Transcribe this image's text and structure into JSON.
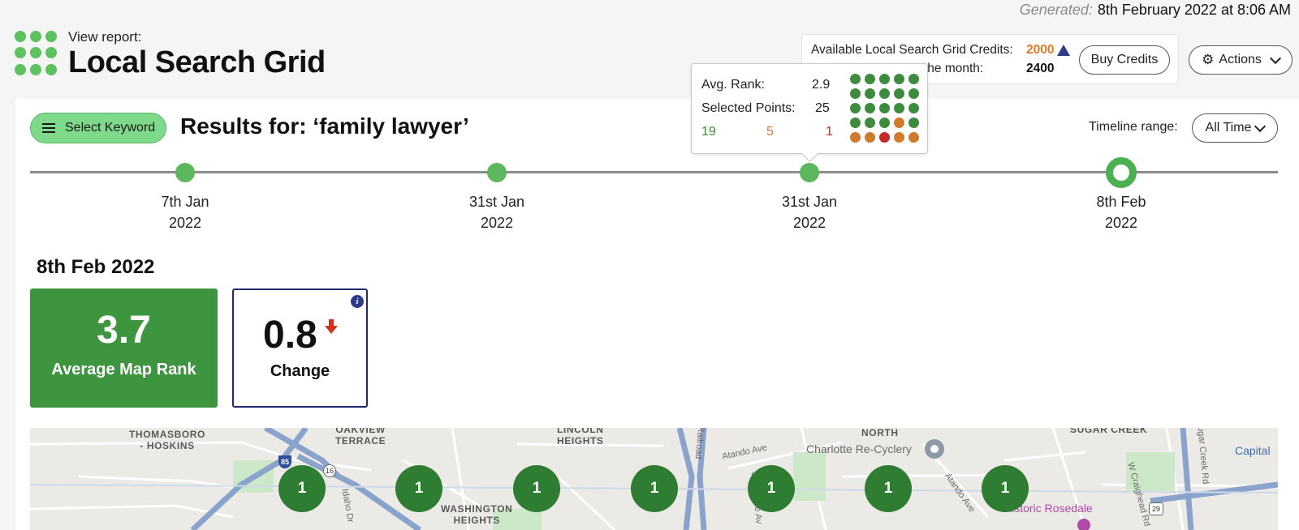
{
  "header": {
    "generated_label": "Generated:",
    "generated_value": "8th February 2022 at 8:06 AM",
    "view_report": "View report:",
    "title": "Local Search Grid"
  },
  "credits": {
    "available_label": "Available Local Search Grid Credits:",
    "available_value": "2000",
    "monthly_label": "the month:",
    "monthly_value": "2400",
    "buy_button": "Buy Credits",
    "warning_icon": "warning-triangle-icon"
  },
  "actions": {
    "label": "Actions",
    "icon": "gear-icon"
  },
  "keyword": {
    "select_button": "Select Keyword",
    "results_for": "Results for: ‘family lawyer’"
  },
  "timeline": {
    "range_label": "Timeline range:",
    "range_value": "All Time",
    "points": [
      {
        "day": "7th Jan",
        "year": "2022",
        "selected": false
      },
      {
        "day": "31st Jan",
        "year": "2022",
        "selected": false
      },
      {
        "day": "31st Jan",
        "year": "2022",
        "selected": false
      },
      {
        "day": "8th Feb",
        "year": "2022",
        "selected": true
      }
    ]
  },
  "tooltip": {
    "avg_rank_label": "Avg. Rank:",
    "avg_rank_value": "2.9",
    "selected_points_label": "Selected Points:",
    "selected_points_value": "25",
    "count_green": "19",
    "count_orange": "5",
    "count_red": "1",
    "grid_colors": [
      "green",
      "green",
      "green",
      "green",
      "green",
      "green",
      "green",
      "green",
      "green",
      "green",
      "green",
      "green",
      "green",
      "green",
      "green",
      "green",
      "green",
      "green",
      "orange",
      "green",
      "orange",
      "orange",
      "red",
      "orange",
      "orange"
    ],
    "colors": {
      "green": "#3d8b3d",
      "orange": "#d07a2c",
      "red": "#c62828"
    }
  },
  "report": {
    "date": "8th Feb 2022",
    "avg_map_rank_value": "3.7",
    "avg_map_rank_label": "Average Map Rank",
    "change_value": "0.8",
    "change_label": "Change",
    "change_direction": "down"
  },
  "map": {
    "labels": [
      {
        "text": "THOMASBORO\n- HOSKINS"
      },
      {
        "text": "OAKVIEW\nTERRACE"
      },
      {
        "text": "LINCOLN\nHEIGHTS"
      },
      {
        "text": "NORTH"
      },
      {
        "text": "SUGAR CREEK"
      },
      {
        "text": "WASHINGTON\nHEIGHTS"
      }
    ],
    "places": {
      "recycery": "Charlotte Re-Cyclery",
      "rosedale": "Historic Rosedale",
      "capital": "Capital",
      "atando1": "Atando Ave",
      "atando2": "Atando Ave",
      "idaho": "Idaho Dr",
      "statesville": "Statesville Av",
      "craighead": "W Craighead Rd",
      "sugarcreekrd": "Sugar Creek Rd",
      "railroad": "Railroad",
      "shield85": "85",
      "shield16": "16",
      "shield29": "29"
    },
    "pins": [
      "1",
      "1",
      "1",
      "1",
      "1",
      "1",
      "1"
    ]
  }
}
